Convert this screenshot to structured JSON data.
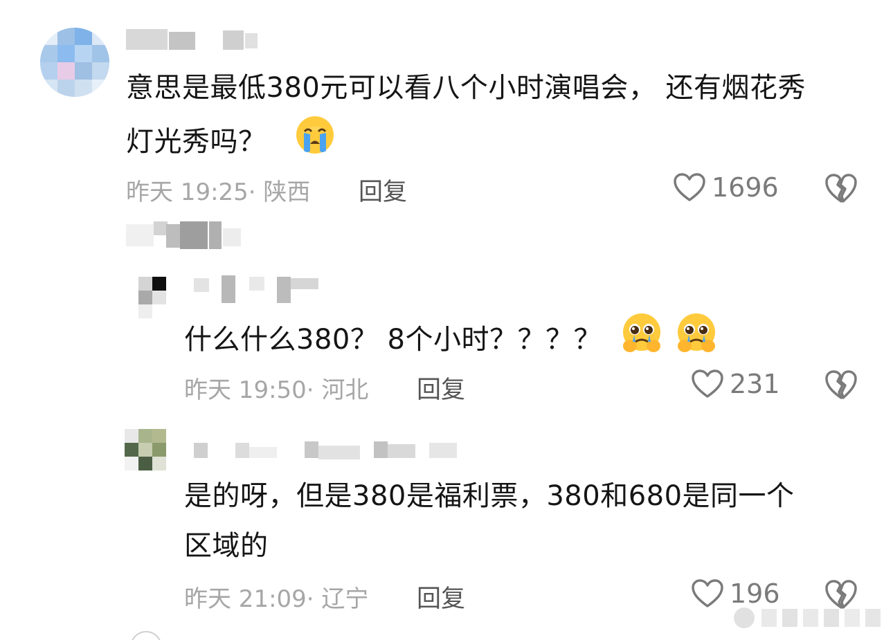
{
  "comments": [
    {
      "text_line1": "意思是最低380元可以看八个小时演唱会， 还有烟花秀",
      "text_line2": "灯光秀吗？",
      "emoji": "loudly-crying-face",
      "time_location": "昨天 19:25· 陕西",
      "reply_label": "回复",
      "likes": "1696"
    },
    {
      "text_line1": "什么什么380？ 8个小时？？？？",
      "emoji": "pleading-face-holding-back-tears",
      "time_location": "昨天 19:50· 河北",
      "reply_label": "回复",
      "likes": "231"
    },
    {
      "text_line1": "是的呀，但是380是福利票，380和680是同一个",
      "text_line2": "区域的",
      "time_location": "昨天 21:09· 辽宁",
      "reply_label": "回复",
      "likes": "196"
    }
  ],
  "icons": {
    "like": "heart-outline-icon",
    "dislike": "broken-heart-icon"
  },
  "colors": {
    "text": "#151515",
    "meta": "#a6a6a6",
    "icon": "#7a7a7a"
  }
}
